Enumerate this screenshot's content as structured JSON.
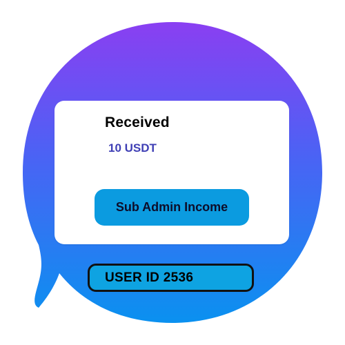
{
  "card": {
    "title": "Received",
    "amount": "10 USDT",
    "action_label": "Sub Admin Income"
  },
  "footer": {
    "user_id": "USER ID 2536"
  },
  "colors": {
    "bubble_top": "#8a3ff2",
    "bubble_mid": "#3f6cf5",
    "bubble_bottom": "#0a8ff0",
    "amount_text": "#3f3fb5",
    "button_bg": "#0b9be0",
    "user_id_bg": "#0ea3e2"
  },
  "icons": {
    "background": "chat-bubble-icon"
  }
}
